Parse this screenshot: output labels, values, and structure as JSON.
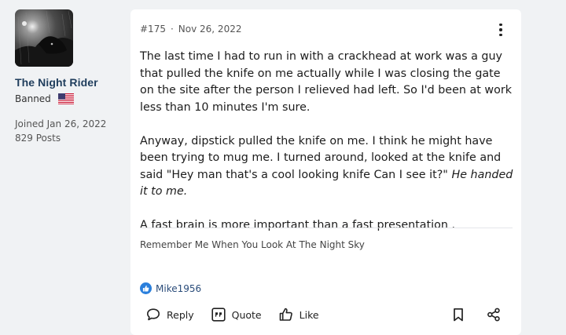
{
  "user": {
    "name": "The Night Rider",
    "role": "Banned",
    "flag_icon": "us-flag-icon",
    "joined": "Joined Jan 26, 2022",
    "posts": "829 Posts"
  },
  "post": {
    "number": "#175",
    "separator": "·",
    "date": "Nov 26, 2022",
    "paragraph1": "The last time I had to run in with a crackhead at work was a guy that pulled the knife on me actually while I was closing the gate on the site after the person I relieved had left. So I'd been at work less than 10 minutes I'm sure.",
    "paragraph2_plain": "Anyway, dipstick pulled the knife on me. I think he might have been trying to mug me. I turned around, looked at the knife and said \"Hey man that's a cool looking knife Can I see it?\" ",
    "paragraph2_italic": "He handed it to me.",
    "paragraph3": "A fast brain is more important than a fast presentation .",
    "signature": "Remember Me When You Look At The Night Sky"
  },
  "reactions": {
    "icon": "thumbs-up-icon",
    "user": "Mike1956"
  },
  "actions": {
    "reply": "Reply",
    "quote": "Quote",
    "like": "Like"
  },
  "colors": {
    "username": "#1f3d5c",
    "accent": "#2a7fdc",
    "page_bg": "#f0f2f4"
  }
}
